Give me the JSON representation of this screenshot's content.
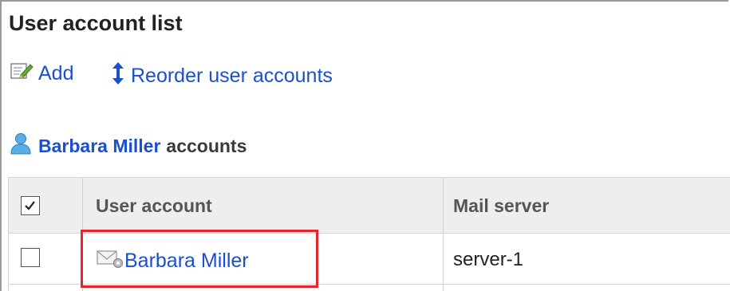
{
  "page": {
    "title": "User account list"
  },
  "toolbar": {
    "add_label": "Add",
    "reorder_label": "Reorder user accounts"
  },
  "section": {
    "user_name": "Barbara Miller",
    "suffix": "accounts"
  },
  "table": {
    "columns": [
      "User account",
      "Mail server"
    ],
    "rows": [
      {
        "checked": false,
        "user_account": "Barbara Miller",
        "mail_server": "server-1"
      }
    ]
  },
  "colors": {
    "link": "#1a4fcf",
    "header_bg": "#eeeeee",
    "highlight": "#e5262d"
  },
  "icons": {
    "add": "edit-note-icon",
    "reorder": "up-down-arrow-icon",
    "user": "user-icon",
    "account": "mail-settings-icon"
  }
}
